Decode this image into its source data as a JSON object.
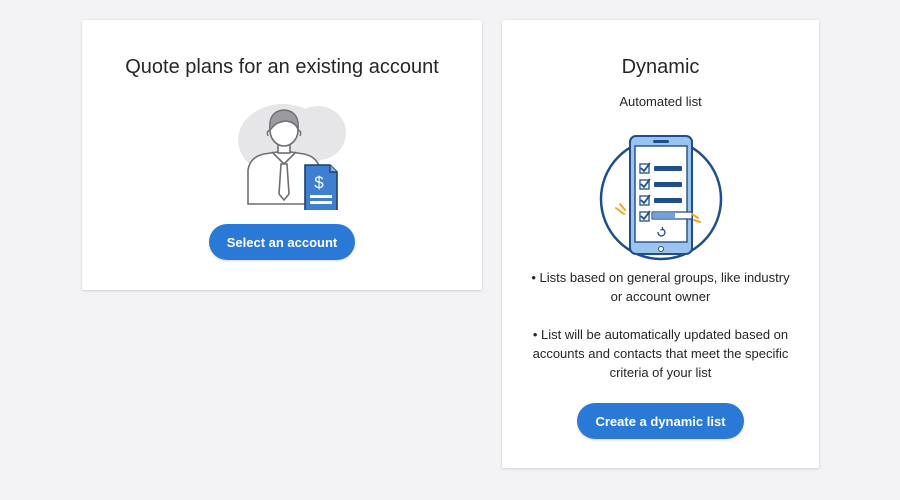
{
  "account_card": {
    "title": "Quote plans for an existing account",
    "button_label": "Select an account",
    "illustration_icon": "person-with-invoice-icon"
  },
  "dynamic_card": {
    "title": "Dynamic",
    "subtitle": "Automated list",
    "illustration_icon": "phone-checklist-icon",
    "bullets": [
      "• Lists based on general groups, like industry or account owner",
      "• List will be automatically updated based on accounts and contacts that meet the specific criteria of your list"
    ],
    "button_label": "Create a dynamic list"
  },
  "colors": {
    "page_background": "#f3f3f5",
    "accent": "#2b79d6",
    "illustration_dark": "#1f4e8c",
    "highlight": "#f5a623"
  }
}
